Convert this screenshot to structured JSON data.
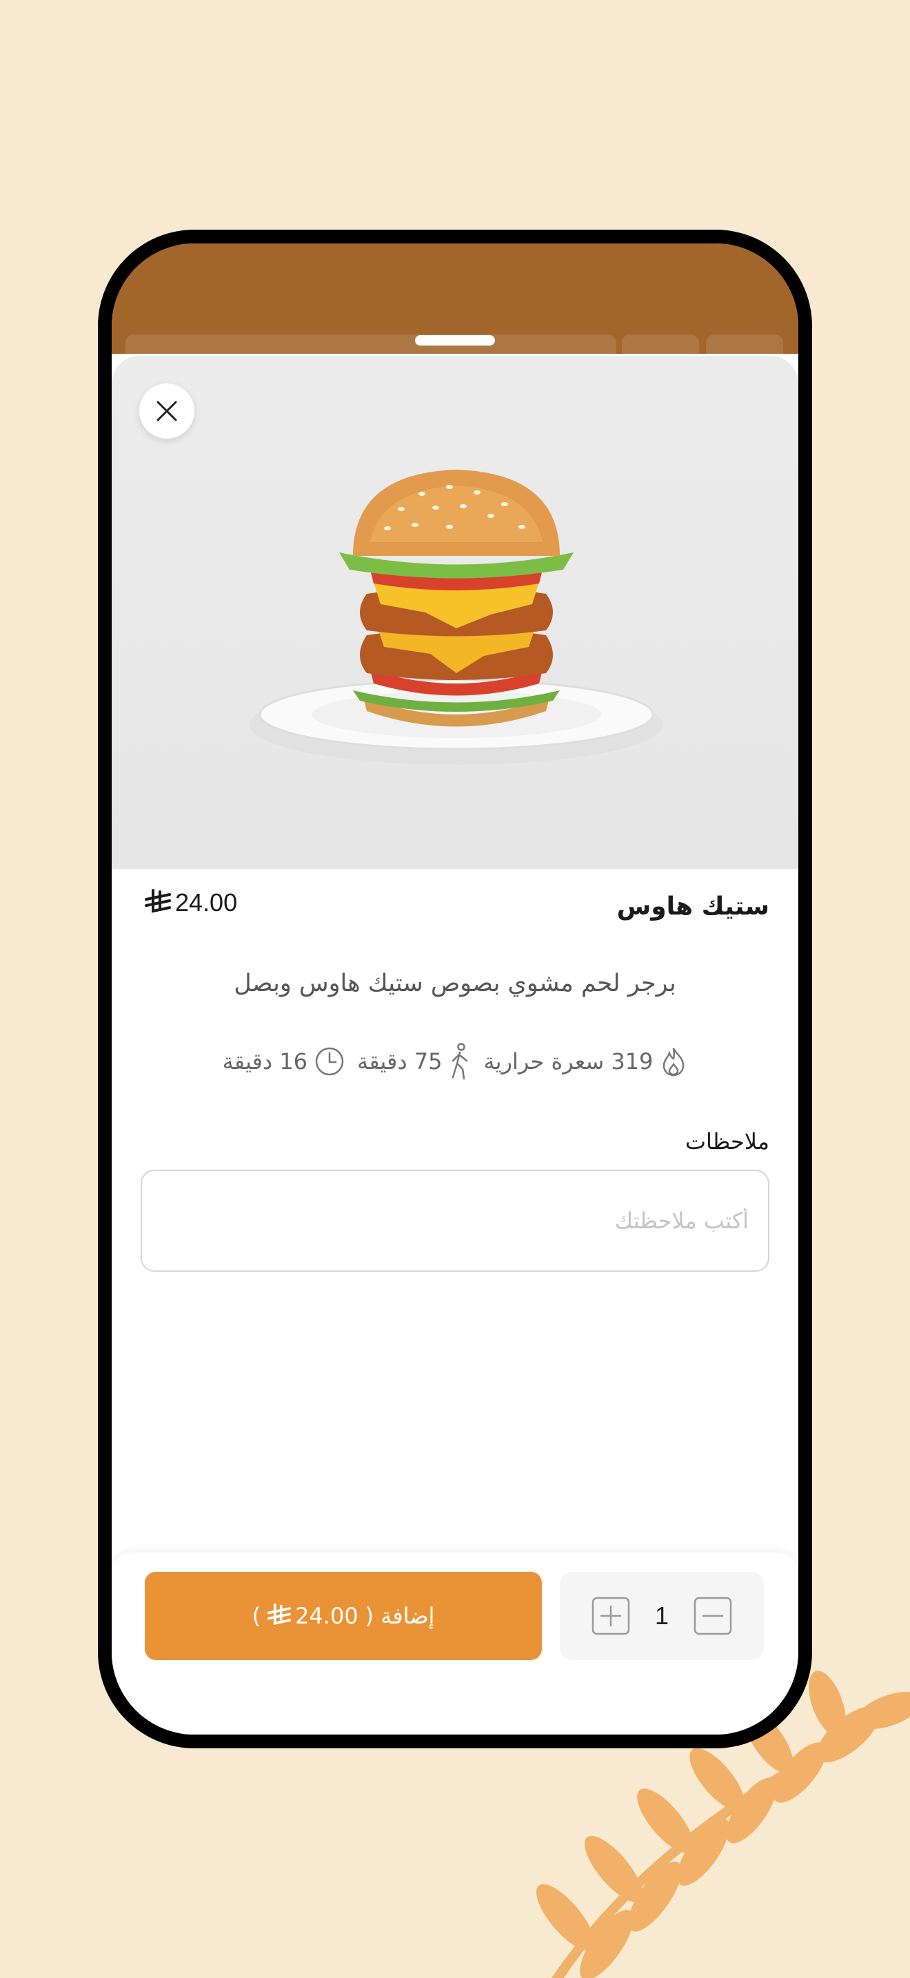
{
  "product": {
    "name": "ستيك هاوس",
    "price": "24.00",
    "description": "برجر لحم مشوي بصوص ستيك هاوس وبصل",
    "calories": "319 سعرة حرارية",
    "walk_time": "75 دقيقة",
    "prep_time": "16 دقيقة"
  },
  "notes": {
    "label": "ملاحظات",
    "placeholder": "أكتب ملاحظتك"
  },
  "cart": {
    "quantity": "1",
    "add_label": "إضافة",
    "add_price": "24.00"
  },
  "colors": {
    "background": "#f8ead0",
    "header": "#a2652a",
    "accent": "#ea9336"
  },
  "icons": {
    "close": "close-icon",
    "riyal": "riyal-icon",
    "calories": "flame-icon",
    "walk": "walking-icon",
    "prep": "clock-icon",
    "increase": "plus-icon",
    "decrease": "minus-icon"
  }
}
